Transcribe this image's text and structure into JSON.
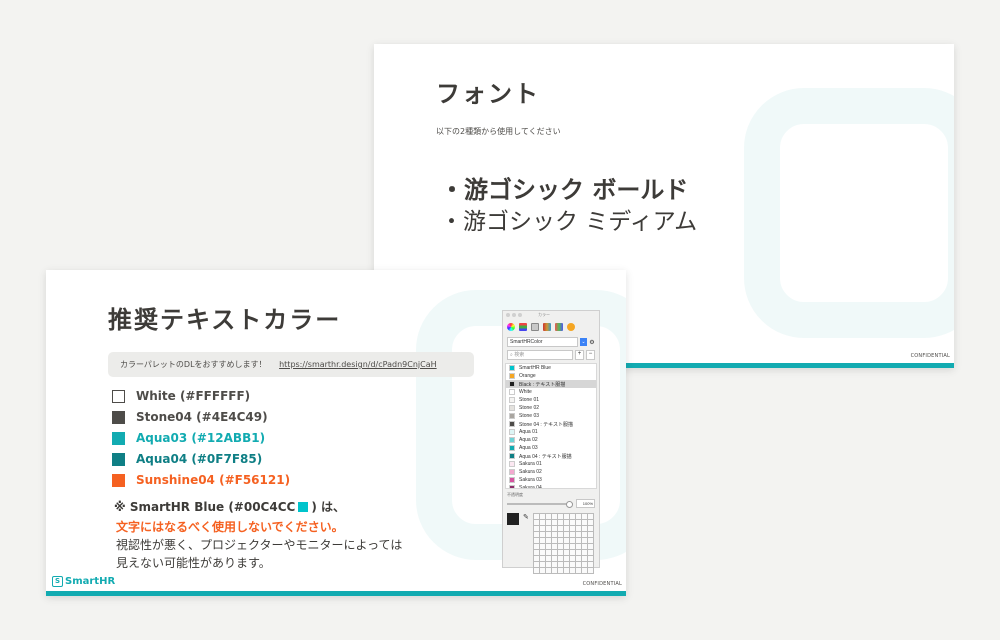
{
  "slide_back": {
    "title": "フォント",
    "subtitle": "以下の2種類から使用してください",
    "font_bold": "・游ゴシック ボールド",
    "font_medium": "・游ゴシック ミディアム",
    "confidential": "CONFIDENTIAL"
  },
  "slide_front": {
    "title": "推奨テキストカラー",
    "callout_text": "カラーパレットのDLをおすすめします！",
    "callout_link": "https://smarthr.design/d/cPadn9CnjCaH",
    "colors": [
      {
        "label": "White (#FFFFFF)",
        "swatch": "#FFFFFF",
        "text_color": "#4E4C49"
      },
      {
        "label": "Stone04 (#4E4C49)",
        "swatch": "#4E4C49",
        "text_color": "#4E4C49"
      },
      {
        "label": "Aqua03 (#12ABB1)",
        "swatch": "#12ABB1",
        "text_color": "#12ABB1"
      },
      {
        "label": "Aqua04 (#0F7F85)",
        "swatch": "#0F7F85",
        "text_color": "#0F7F85"
      },
      {
        "label": "Sunshine04 (#F56121)",
        "swatch": "#F56121",
        "text_color": "#F56121"
      }
    ],
    "note_prefix": "※ SmartHR Blue (#00C4CC",
    "note_suffix": ") は、",
    "note_warning": "文字にはなるべく使用しないでください。",
    "note_line3": "視認性が悪く、プロジェクターやモニターによっては",
    "note_line4": "見えない可能性があります。",
    "logo_text": "SmartHR",
    "logo_mark": "S",
    "confidential": "CONFIDENTIAL"
  },
  "picker": {
    "title": "カラー",
    "palette": "SmartHRColor",
    "search_placeholder": "検索",
    "items": [
      {
        "name": "SmartHR Blue",
        "color": "#00C4CC",
        "selected": false
      },
      {
        "name": "Orange",
        "color": "#F5A623",
        "selected": false
      },
      {
        "name": "Black : テキスト服描",
        "color": "#222222",
        "selected": true
      },
      {
        "name": "White",
        "color": "#FFFFFF",
        "selected": false
      },
      {
        "name": "Stone 01",
        "color": "#F5F4F2",
        "selected": false
      },
      {
        "name": "Stone 02",
        "color": "#E4E2DE",
        "selected": false
      },
      {
        "name": "Stone 03",
        "color": "#A9A5A0",
        "selected": false
      },
      {
        "name": "Stone 04 : テキスト服描",
        "color": "#4E4C49",
        "selected": false
      },
      {
        "name": "Aqua 01",
        "color": "#DDF5F5",
        "selected": false
      },
      {
        "name": "Aqua 02",
        "color": "#6FD3D6",
        "selected": false
      },
      {
        "name": "Aqua 03",
        "color": "#12ABB1",
        "selected": false
      },
      {
        "name": "Aqua 04 : テキスト服描",
        "color": "#0F7F85",
        "selected": false
      },
      {
        "name": "Sakura 01",
        "color": "#FCE8F2",
        "selected": false
      },
      {
        "name": "Sakura 02",
        "color": "#F3A9CF",
        "selected": false
      },
      {
        "name": "Sakura 03",
        "color": "#D654A0",
        "selected": false
      },
      {
        "name": "Sakura 04",
        "color": "#8E2E6A",
        "selected": false
      }
    ],
    "opacity_label": "不透明度",
    "opacity_value": "100%"
  }
}
